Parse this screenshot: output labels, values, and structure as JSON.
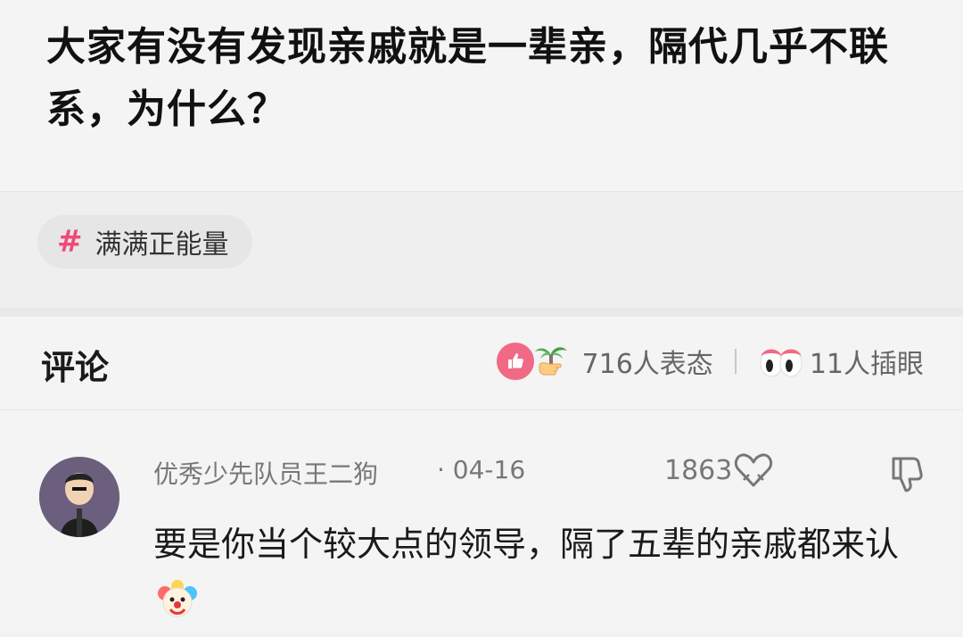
{
  "question": {
    "title": "大家有没有发现亲戚就是一辈亲，隔代几乎不联系，为什么？"
  },
  "topic": {
    "hash": "#",
    "label": "满满正能量"
  },
  "comments_header": {
    "title": "评论",
    "reaction_count_text": "716人表态",
    "eyes_count_text": "11人插眼"
  },
  "comment": {
    "author": "优秀少先队员王二狗",
    "date": "· 04-16",
    "like_count": "1863",
    "text": "要是你当个较大点的领导，隔了五辈的亲戚都来认",
    "icons": [
      "thumbs-up-icon",
      "palm-tree-icon",
      "eyes-icon",
      "heart-icon",
      "thumbs-down-icon",
      "clown-icon"
    ]
  },
  "colors": {
    "accent_pink": "#f0487a",
    "thumb_bg": "#f06a86",
    "background": "#f2f2f2"
  }
}
